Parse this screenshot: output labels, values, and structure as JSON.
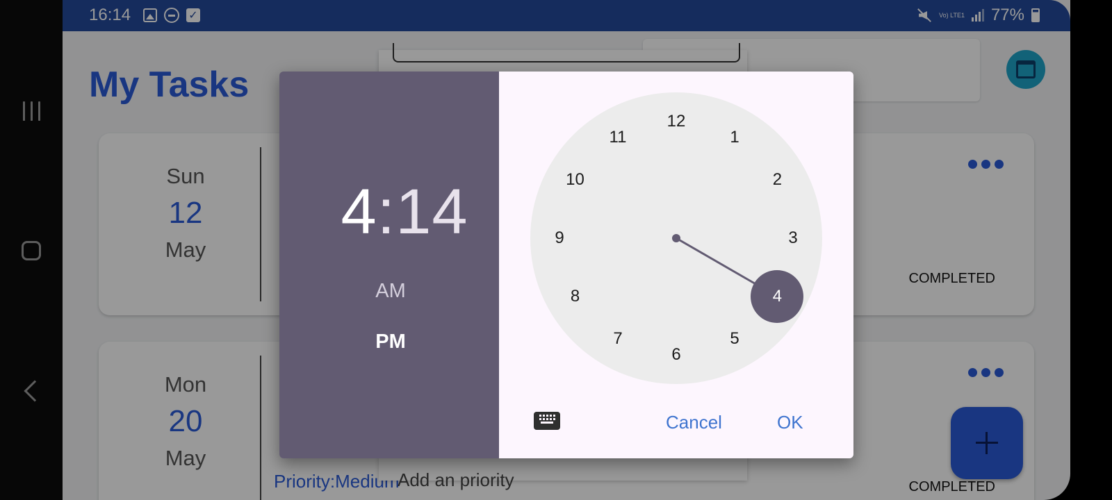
{
  "status_bar": {
    "time": "16:14",
    "battery": "77%",
    "network": "Vo) LTE1"
  },
  "app": {
    "title": "My Tasks",
    "tasks": [
      {
        "day": "Sun",
        "date": "12",
        "month": "May",
        "status": "COMPLETED",
        "priority": ""
      },
      {
        "day": "Mon",
        "date": "20",
        "month": "May",
        "status": "COMPLETED",
        "priority": "Priority:Medium"
      }
    ],
    "form": {
      "priority_placeholder": "Add an priority"
    }
  },
  "time_picker": {
    "hour": "4",
    "separator": ":",
    "minute": "14",
    "am_label": "AM",
    "pm_label": "PM",
    "selected_period": "PM",
    "selected_hour": 4,
    "clock_numbers": [
      "12",
      "1",
      "2",
      "3",
      "4",
      "5",
      "6",
      "7",
      "8",
      "9",
      "10",
      "11"
    ],
    "cancel_label": "Cancel",
    "ok_label": "OK",
    "accent_color": "#625b72"
  },
  "icons": {
    "nav": [
      "recents-icon",
      "home-icon",
      "back-icon"
    ],
    "header": "calendar-alarm-icon",
    "dialog": "keyboard-icon",
    "fab": "plus-icon"
  }
}
